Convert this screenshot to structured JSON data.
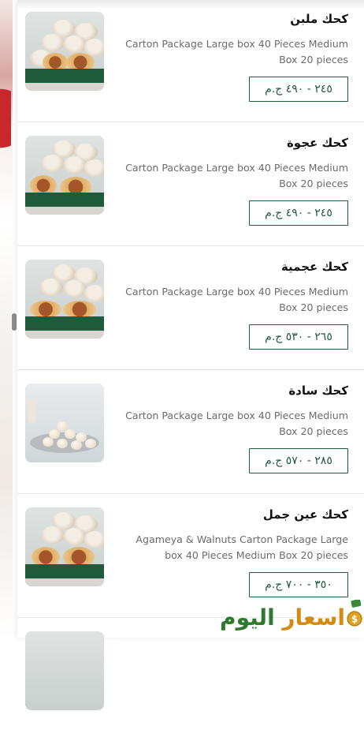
{
  "items": [
    {
      "title": "كحك ملبن",
      "description": "Carton Package Large box 40 Pieces Medium Box 20 pieces",
      "price": "٢٤٥ - ٤٩٠ ج.م"
    },
    {
      "title": "كحك عجوة",
      "description": "Carton Package Large box 40 Pieces Medium Box 20 pieces",
      "price": "٢٤٥ - ٤٩٠ ج.م"
    },
    {
      "title": "كحك عجمية",
      "description": "Carton Package Large box 40 Pieces Medium Box 20 pieces",
      "price": "٢٦٥ - ٥٣٠ ج.م"
    },
    {
      "title": "كحك سادة",
      "description": "Carton Package Large box 40 Pieces Medium Box 20 pieces",
      "price": "٢٨٥ - ٥٧٠ ج.م"
    },
    {
      "title": "كحك عين جمل",
      "description": "Agameya & Walnuts Carton Package Large box 40 Pieces Medium Box 20 pieces",
      "price": "٣٥٠ - ٧٠٠ ج.م"
    }
  ],
  "watermark": {
    "word1": "اسعار",
    "word2": "اليوم"
  },
  "icons": {
    "thumbnail": "product-photo-icon",
    "logo": "money-bag-icon"
  },
  "colors": {
    "accent": "#1f5a3b",
    "text": "#111111",
    "muted": "#6b6b6b",
    "logo_orange": "#d58a12",
    "logo_green": "#2e7a2e"
  }
}
